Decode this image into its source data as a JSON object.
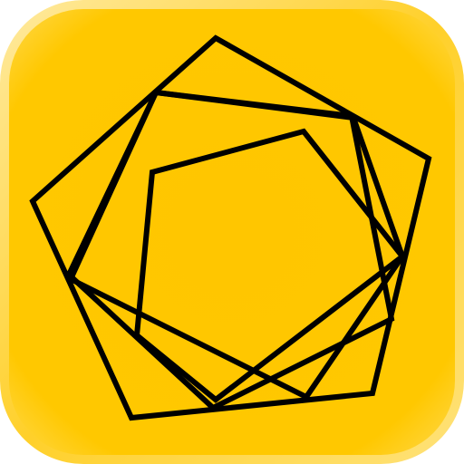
{
  "icon": {
    "name": "nested-pentagons-logo-icon",
    "colors": {
      "background_inner": "#FFC700",
      "background_outer": "#FFD22A",
      "rim_highlight": "#FFE58A",
      "stroke": "#000000"
    }
  }
}
